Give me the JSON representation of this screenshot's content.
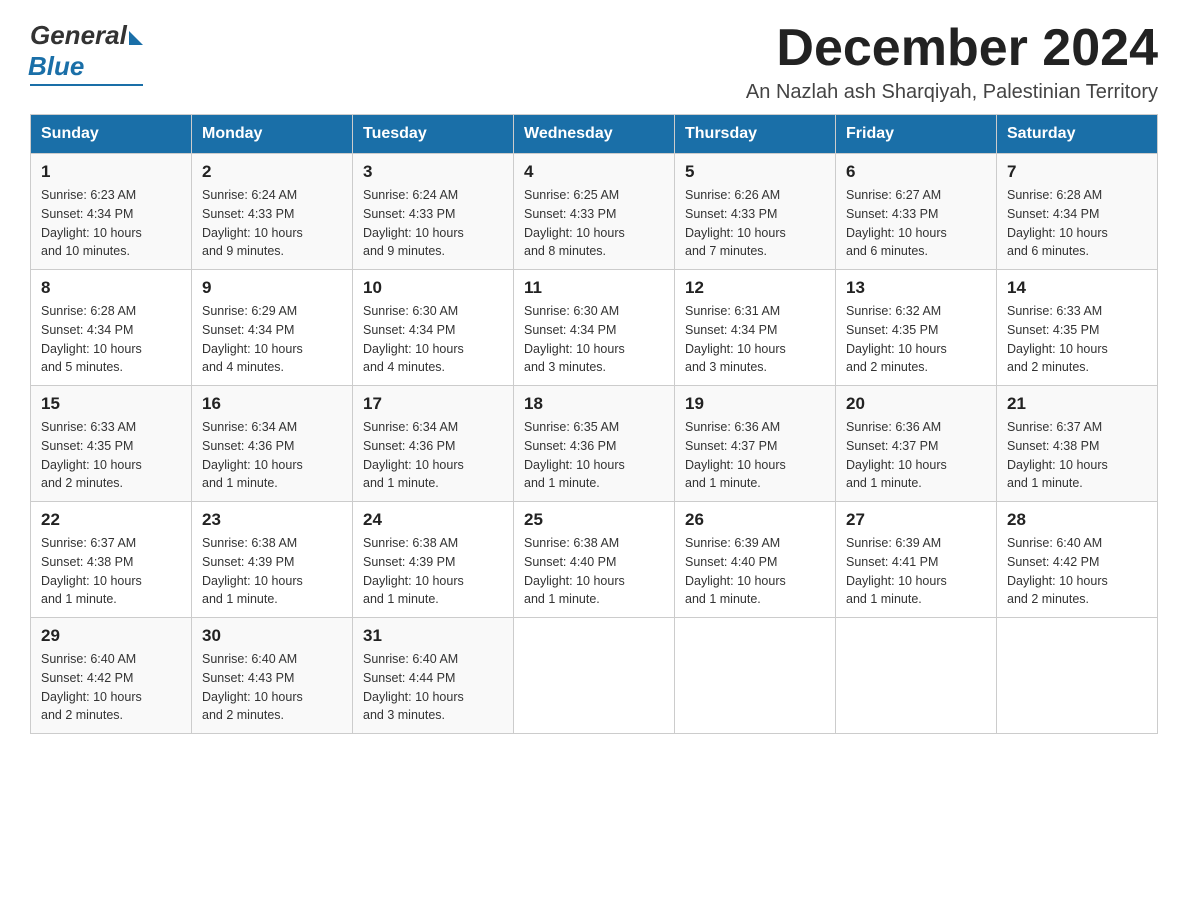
{
  "header": {
    "logo_general": "General",
    "logo_blue": "Blue",
    "month_title": "December 2024",
    "subtitle": "An Nazlah ash Sharqiyah, Palestinian Territory"
  },
  "weekdays": [
    "Sunday",
    "Monday",
    "Tuesday",
    "Wednesday",
    "Thursday",
    "Friday",
    "Saturday"
  ],
  "weeks": [
    [
      {
        "day": "1",
        "sunrise": "6:23 AM",
        "sunset": "4:34 PM",
        "daylight": "10 hours and 10 minutes."
      },
      {
        "day": "2",
        "sunrise": "6:24 AM",
        "sunset": "4:33 PM",
        "daylight": "10 hours and 9 minutes."
      },
      {
        "day": "3",
        "sunrise": "6:24 AM",
        "sunset": "4:33 PM",
        "daylight": "10 hours and 9 minutes."
      },
      {
        "day": "4",
        "sunrise": "6:25 AM",
        "sunset": "4:33 PM",
        "daylight": "10 hours and 8 minutes."
      },
      {
        "day": "5",
        "sunrise": "6:26 AM",
        "sunset": "4:33 PM",
        "daylight": "10 hours and 7 minutes."
      },
      {
        "day": "6",
        "sunrise": "6:27 AM",
        "sunset": "4:33 PM",
        "daylight": "10 hours and 6 minutes."
      },
      {
        "day": "7",
        "sunrise": "6:28 AM",
        "sunset": "4:34 PM",
        "daylight": "10 hours and 6 minutes."
      }
    ],
    [
      {
        "day": "8",
        "sunrise": "6:28 AM",
        "sunset": "4:34 PM",
        "daylight": "10 hours and 5 minutes."
      },
      {
        "day": "9",
        "sunrise": "6:29 AM",
        "sunset": "4:34 PM",
        "daylight": "10 hours and 4 minutes."
      },
      {
        "day": "10",
        "sunrise": "6:30 AM",
        "sunset": "4:34 PM",
        "daylight": "10 hours and 4 minutes."
      },
      {
        "day": "11",
        "sunrise": "6:30 AM",
        "sunset": "4:34 PM",
        "daylight": "10 hours and 3 minutes."
      },
      {
        "day": "12",
        "sunrise": "6:31 AM",
        "sunset": "4:34 PM",
        "daylight": "10 hours and 3 minutes."
      },
      {
        "day": "13",
        "sunrise": "6:32 AM",
        "sunset": "4:35 PM",
        "daylight": "10 hours and 2 minutes."
      },
      {
        "day": "14",
        "sunrise": "6:33 AM",
        "sunset": "4:35 PM",
        "daylight": "10 hours and 2 minutes."
      }
    ],
    [
      {
        "day": "15",
        "sunrise": "6:33 AM",
        "sunset": "4:35 PM",
        "daylight": "10 hours and 2 minutes."
      },
      {
        "day": "16",
        "sunrise": "6:34 AM",
        "sunset": "4:36 PM",
        "daylight": "10 hours and 1 minute."
      },
      {
        "day": "17",
        "sunrise": "6:34 AM",
        "sunset": "4:36 PM",
        "daylight": "10 hours and 1 minute."
      },
      {
        "day": "18",
        "sunrise": "6:35 AM",
        "sunset": "4:36 PM",
        "daylight": "10 hours and 1 minute."
      },
      {
        "day": "19",
        "sunrise": "6:36 AM",
        "sunset": "4:37 PM",
        "daylight": "10 hours and 1 minute."
      },
      {
        "day": "20",
        "sunrise": "6:36 AM",
        "sunset": "4:37 PM",
        "daylight": "10 hours and 1 minute."
      },
      {
        "day": "21",
        "sunrise": "6:37 AM",
        "sunset": "4:38 PM",
        "daylight": "10 hours and 1 minute."
      }
    ],
    [
      {
        "day": "22",
        "sunrise": "6:37 AM",
        "sunset": "4:38 PM",
        "daylight": "10 hours and 1 minute."
      },
      {
        "day": "23",
        "sunrise": "6:38 AM",
        "sunset": "4:39 PM",
        "daylight": "10 hours and 1 minute."
      },
      {
        "day": "24",
        "sunrise": "6:38 AM",
        "sunset": "4:39 PM",
        "daylight": "10 hours and 1 minute."
      },
      {
        "day": "25",
        "sunrise": "6:38 AM",
        "sunset": "4:40 PM",
        "daylight": "10 hours and 1 minute."
      },
      {
        "day": "26",
        "sunrise": "6:39 AM",
        "sunset": "4:40 PM",
        "daylight": "10 hours and 1 minute."
      },
      {
        "day": "27",
        "sunrise": "6:39 AM",
        "sunset": "4:41 PM",
        "daylight": "10 hours and 1 minute."
      },
      {
        "day": "28",
        "sunrise": "6:40 AM",
        "sunset": "4:42 PM",
        "daylight": "10 hours and 2 minutes."
      }
    ],
    [
      {
        "day": "29",
        "sunrise": "6:40 AM",
        "sunset": "4:42 PM",
        "daylight": "10 hours and 2 minutes."
      },
      {
        "day": "30",
        "sunrise": "6:40 AM",
        "sunset": "4:43 PM",
        "daylight": "10 hours and 2 minutes."
      },
      {
        "day": "31",
        "sunrise": "6:40 AM",
        "sunset": "4:44 PM",
        "daylight": "10 hours and 3 minutes."
      },
      null,
      null,
      null,
      null
    ]
  ],
  "labels": {
    "sunrise": "Sunrise:",
    "sunset": "Sunset:",
    "daylight": "Daylight:"
  }
}
